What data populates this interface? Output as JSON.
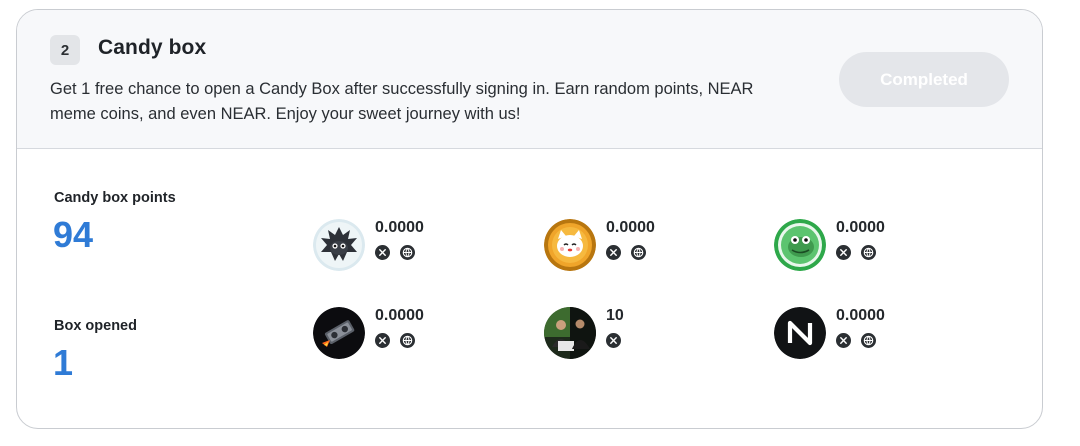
{
  "task": {
    "step_number": "2",
    "title": "Candy box",
    "description": "Get 1 free chance to open a Candy Box after successfully signing in. Earn random points, NEAR meme coins, and even NEAR. Enjoy your sweet journey with us!",
    "status_label": "Completed"
  },
  "stats": {
    "points_label": "Candy box points",
    "points_value": "94",
    "opened_label": "Box opened",
    "opened_value": "1"
  },
  "colors": {
    "accent_blue": "#2f7bd6",
    "completed_button_bg": "#e4e6ea"
  },
  "tokens": [
    {
      "amount": "0.0000",
      "icon": "dragon-coin-icon",
      "links": [
        "x-icon",
        "globe-icon"
      ]
    },
    {
      "amount": "0.0000",
      "icon": "lucky-cat-coin-icon",
      "links": [
        "x-icon",
        "globe-icon"
      ]
    },
    {
      "amount": "0.0000",
      "icon": "frog-coin-icon",
      "links": [
        "x-icon",
        "globe-icon"
      ]
    },
    {
      "amount": "0.0000",
      "icon": "rocket-gpu-coin-icon",
      "links": [
        "x-icon",
        "globe-icon"
      ]
    },
    {
      "amount": "10",
      "icon": "photo-coin-icon",
      "links": [
        "x-icon"
      ]
    },
    {
      "amount": "0.0000",
      "icon": "near-logo-icon",
      "links": [
        "x-icon",
        "globe-icon"
      ]
    }
  ]
}
